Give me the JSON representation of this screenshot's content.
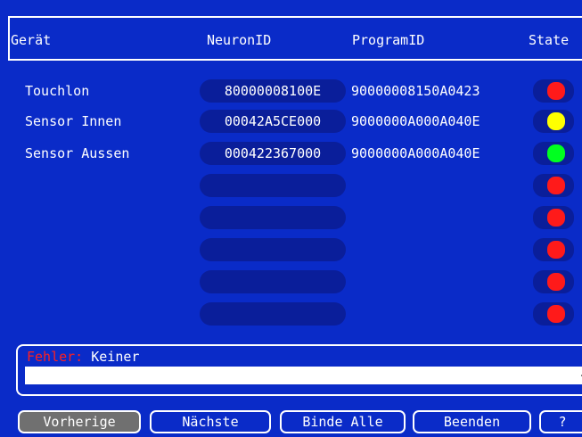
{
  "header": {
    "device": "Gerät",
    "neuron_id": "NeuronID",
    "program_id": "ProgramID",
    "state": "State"
  },
  "rows": [
    {
      "device": "Touchlon",
      "neuron_id": "80000008100E",
      "program_id": "90000008150A0423",
      "state_color": "#ff1a1a"
    },
    {
      "device": "Sensor Innen",
      "neuron_id": "00042A5CE000",
      "program_id": "9000000A000A040E",
      "state_color": "#ffff00"
    },
    {
      "device": "Sensor Aussen",
      "neuron_id": "000422367000",
      "program_id": "9000000A000A040E",
      "state_color": "#00ff20"
    },
    {
      "device": "",
      "neuron_id": "",
      "program_id": "",
      "state_color": "#ff1a1a"
    },
    {
      "device": "",
      "neuron_id": "",
      "program_id": "",
      "state_color": "#ff1a1a"
    },
    {
      "device": "",
      "neuron_id": "",
      "program_id": "",
      "state_color": "#ff1a1a"
    },
    {
      "device": "",
      "neuron_id": "",
      "program_id": "",
      "state_color": "#ff1a1a"
    },
    {
      "device": "",
      "neuron_id": "",
      "program_id": "",
      "state_color": "#ff1a1a"
    }
  ],
  "error": {
    "label": "Fehler:",
    "value": "Keiner",
    "field_value": "",
    "scroll_icon": "arrow-right-icon",
    "scroll_glyph": "→"
  },
  "buttons": {
    "previous": "Vorherige",
    "next": "Nächste",
    "bind_all": "Binde Alle",
    "quit": "Beenden",
    "help": "?"
  },
  "colors": {
    "background": "#0a2bc8",
    "pill": "#0a1e9a",
    "error_label": "#ff2020",
    "pressed_button": "#707070"
  }
}
